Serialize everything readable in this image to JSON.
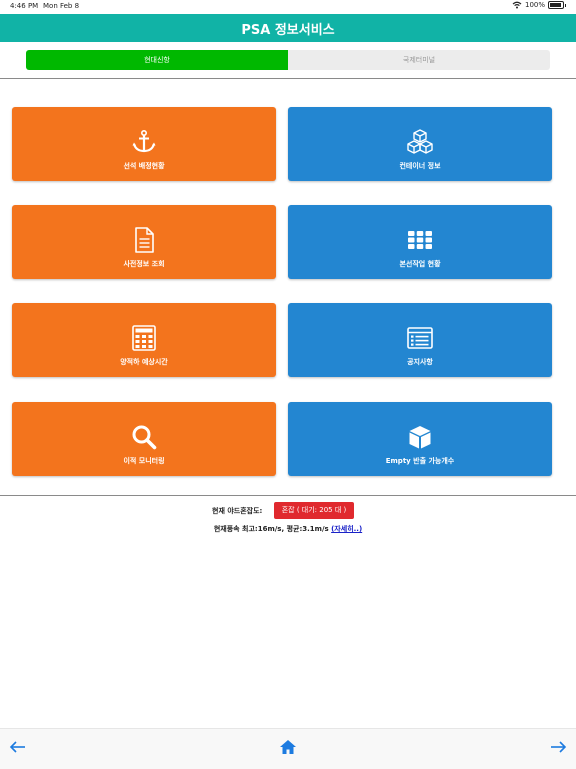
{
  "status_bar": {
    "time": "4:46 PM",
    "date": "Mon Feb 8",
    "battery": "100%"
  },
  "header": {
    "title": "PSA 정보서비스"
  },
  "segments": [
    {
      "label": "현대신항",
      "active": true
    },
    {
      "label": "국제터미널",
      "active": false
    }
  ],
  "tiles": [
    {
      "label": "선석 배정현황",
      "icon": "anchor-icon",
      "color": "#f3741d"
    },
    {
      "label": "컨테이너 정보",
      "icon": "containers-icon",
      "color": "#2386d1"
    },
    {
      "label": "사전정보 조회",
      "icon": "document-icon",
      "color": "#f3741d"
    },
    {
      "label": "본선작업 현황",
      "icon": "grid-icon",
      "color": "#2386d1"
    },
    {
      "label": "양적하 예상시간",
      "icon": "calculator-icon",
      "color": "#f3741d"
    },
    {
      "label": "공지사항",
      "icon": "notice-list-icon",
      "color": "#2386d1"
    },
    {
      "label": "이적 모니터링",
      "icon": "search-icon",
      "color": "#f3741d"
    },
    {
      "label": "Empty 반출 가능개수",
      "icon": "box-icon",
      "color": "#2386d1"
    }
  ],
  "yard": {
    "label": "현재 야드혼잡도:",
    "status": "혼잡 ( 대기: 205 대 )",
    "status_color": "#e0292e"
  },
  "wind": {
    "text": "현재풍속 최고:16m/s, 평균:3.1m/s ",
    "link": "(자세히..)"
  },
  "bottom_nav": {
    "back": "arrow-left-icon",
    "home": "home-icon",
    "forward": "arrow-right-icon",
    "accent": "#1d7be0"
  }
}
